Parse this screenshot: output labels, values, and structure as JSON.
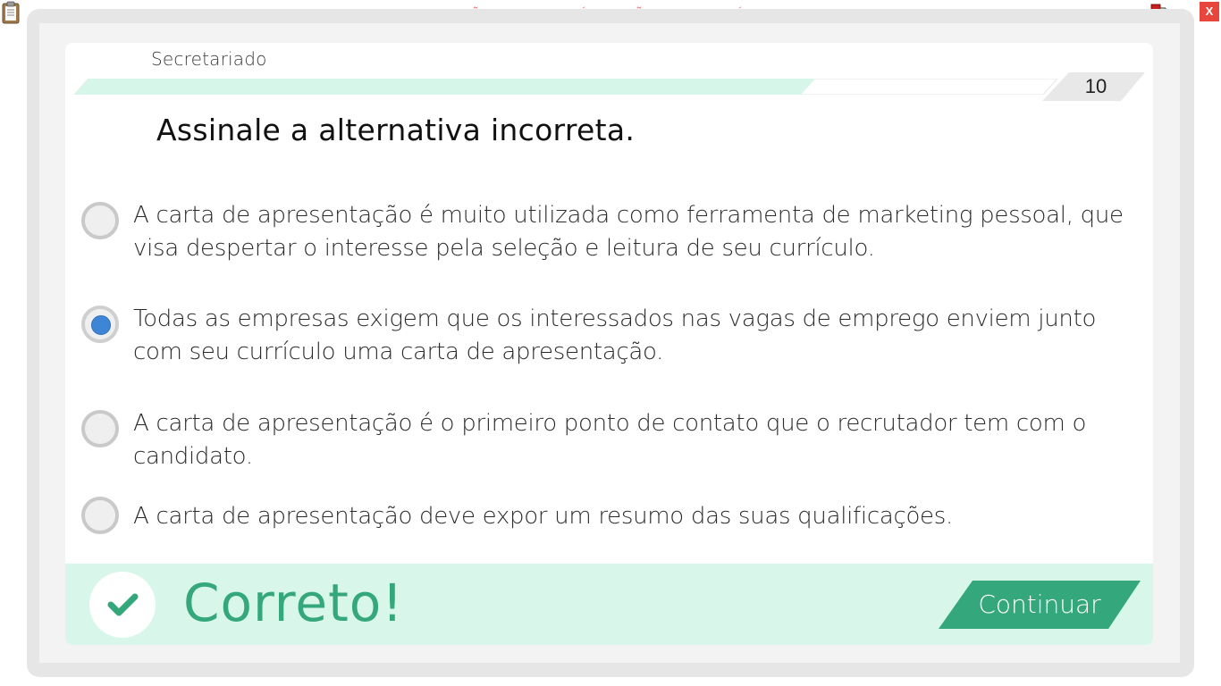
{
  "window": {
    "banner": "VERSÃO PARA FUNCIONÁRIOS - NÃO COMERCIALIZÁVEL",
    "close_label": "X"
  },
  "quiz": {
    "subject": "Secretariado",
    "question_number": "10",
    "progress_fraction": 0.75,
    "question": "Assinale a alternativa incorreta.",
    "options": [
      {
        "text": "A carta de apresentação é muito utilizada como ferramenta de marketing pessoal, que visa despertar o interesse pela seleção e leitura de seu currículo.",
        "selected": false
      },
      {
        "text": "Todas as empresas exigem que os interessados nas vagas de emprego enviem junto com seu currículo uma carta de apresentação.",
        "selected": true
      },
      {
        "text": "A carta de apresentação é o primeiro ponto de contato que o recrutador tem com o candidato.",
        "selected": false
      },
      {
        "text": "A carta de apresentação deve expor um resumo das suas qualificações.",
        "selected": false
      }
    ]
  },
  "feedback": {
    "result_text": "Correto!",
    "continue_label": "Continuar"
  },
  "colors": {
    "accent_green": "#35a77d",
    "feedback_bg": "#d8f7ea",
    "progress_fill": "#d6f6ea",
    "selected_radio": "#3f85d6"
  },
  "icons": [
    "clipboard-icon",
    "network-status-icon",
    "check-icon"
  ]
}
